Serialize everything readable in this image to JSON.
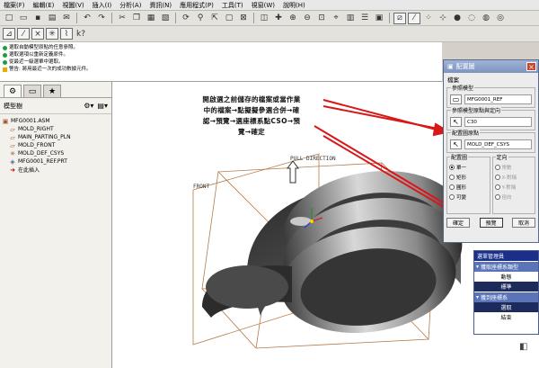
{
  "menubar": [
    "檔案(F)",
    "編輯(E)",
    "視圖(V)",
    "插入(I)",
    "分析(A)",
    "資訊(N)",
    "應用程式(P)",
    "工具(T)",
    "視窗(W)",
    "說明(H)"
  ],
  "messages": [
    {
      "icon": "ok",
      "text": "選取自動模型原點的任意參照。"
    },
    {
      "icon": "ok",
      "text": "選取選項以重新定義原件。"
    },
    {
      "icon": "ok",
      "text": "從最近一級選單中選取。"
    },
    {
      "icon": "warn",
      "text": "警告: 將用最近一次的成功數據元件。"
    }
  ],
  "left_pane": {
    "header": "模型樹",
    "tree": [
      {
        "label": "MFG0001.ASM",
        "level": 0,
        "icon": "assembly-icon"
      },
      {
        "label": "MOLD_RIGHT",
        "level": 1,
        "icon": "datum-plane-icon"
      },
      {
        "label": "MAIN_PARTING_PLN",
        "level": 1,
        "icon": "datum-plane-icon"
      },
      {
        "label": "MOLD_FRONT",
        "level": 1,
        "icon": "datum-plane-icon"
      },
      {
        "label": "MOLD_DEF_CSYS",
        "level": 1,
        "icon": "csys-icon"
      },
      {
        "label": "MFG0001_REF.PRT",
        "level": 1,
        "icon": "part-icon"
      },
      {
        "label": "在此插入",
        "level": 1,
        "icon": "insert-arrow-icon"
      }
    ]
  },
  "graphics": {
    "annotation": [
      "開啟選之前儲存的檔案或當作業",
      "中的檔案→點擬擬參選合併→確",
      "認→預覽→選座標系點CSO→預",
      "覽→確定"
    ],
    "labels": {
      "pull_direction": "PULL DIRECTION",
      "front": "FRONT"
    }
  },
  "dialog": {
    "title": "配置圖",
    "sub": "檔案",
    "ref_model_caption": "參照模型",
    "ref_model_value": "MFG0001_REF",
    "origin_caption": "參照模型原點與定向",
    "origin_value": "C30",
    "layout_origin_caption": "配置圖原點",
    "layout_origin_value": "MOLD_DEF_CSYS",
    "layout_caption": "配置圖",
    "layout_options": [
      "單一",
      "矩形",
      "圓形",
      "可變"
    ],
    "orient_caption": "定向",
    "orient_options": [
      "常數",
      "X-對稱",
      "Y-對稱",
      "徑向"
    ],
    "ok": "確定",
    "preview": "預覽",
    "cancel": "取消"
  },
  "menu_manager": {
    "title": "選單管理員",
    "section1": "獲取座標系類型",
    "section1_items": [
      "動態",
      "標準"
    ],
    "section2": "獲到座標系",
    "section2_items": [
      "選取",
      "結束"
    ]
  }
}
